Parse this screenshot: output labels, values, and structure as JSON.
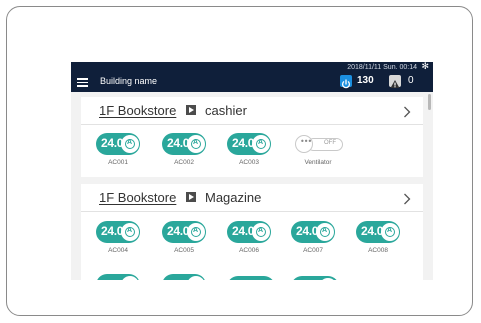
{
  "topbar": {
    "building_name": "Building name",
    "datetime": "2018/11/11 Sun. 00:14",
    "power_count": "130",
    "alert_count": "0",
    "bar_color": "#0f1f3a",
    "power_badge_color": "#1b8fe0"
  },
  "icons": {
    "menu": "hamburger-menu-icon",
    "settings": "gear-icon",
    "power": "power-icon",
    "alert": "warning-icon",
    "arrow": "triangle-right-icon",
    "chevron": "chevron-right-icon",
    "mode": "auto-mode-icon",
    "more": "ellipsis-icon"
  },
  "colors": {
    "unit_on": "#2aa79b",
    "card_bg": "#ffffff",
    "screen_bg": "#f2f2f2"
  },
  "groups": [
    {
      "location": "1F Bookstore",
      "area": "cashier",
      "units": [
        {
          "temp": "24.0",
          "mode": "A",
          "label": "AC001"
        },
        {
          "temp": "24.0",
          "mode": "A",
          "label": "AC002"
        },
        {
          "temp": "24.0",
          "mode": "A",
          "label": "AC003"
        }
      ],
      "ventilator": {
        "state": "OFF",
        "label": "Ventilator",
        "knob": "•••"
      }
    },
    {
      "location": "1F Bookstore",
      "area": "Magazine",
      "units": [
        {
          "temp": "24.0",
          "mode": "A",
          "label": "AC004"
        },
        {
          "temp": "24.0",
          "mode": "A",
          "label": "AC005"
        },
        {
          "temp": "24.0",
          "mode": "A",
          "label": "AC006"
        },
        {
          "temp": "24.0",
          "mode": "A",
          "label": "AC007"
        },
        {
          "temp": "24.0",
          "mode": "A",
          "label": "AC008"
        }
      ]
    }
  ],
  "symbols": {
    "degree": "°",
    "gear": "✻",
    "chevron": "›"
  }
}
